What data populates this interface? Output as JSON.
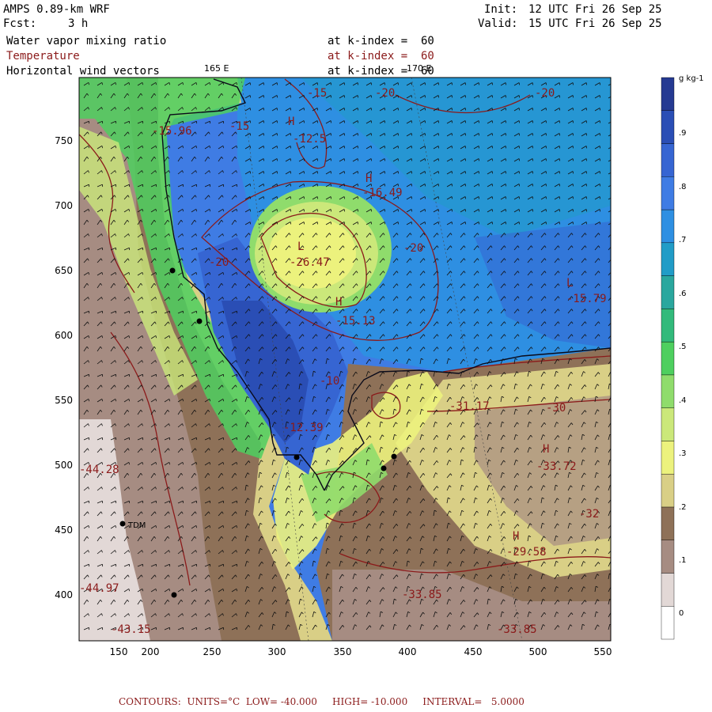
{
  "header": {
    "model": "AMPS 0.89-km WRF",
    "fcst_label": "Fcst:",
    "fcst_value": "3 h",
    "init_label": "Init:",
    "init_value": "12 UTC Fri 26 Sep 25",
    "valid_label": "Valid:",
    "valid_value": "15 UTC Fri 26 Sep 25"
  },
  "fields": [
    {
      "name": "Water vapor mixing ratio",
      "level": "at k-index =  60"
    },
    {
      "name": "Temperature",
      "level": "at k-index =  60"
    },
    {
      "name": "Horizontal wind vectors",
      "level": "at k-index =  60"
    }
  ],
  "map": {
    "meridians": [
      "165 E",
      "170 E"
    ],
    "landmark": "TDM",
    "x_ticks": [
      "150",
      "200",
      "250",
      "300",
      "350",
      "400",
      "450",
      "500",
      "550"
    ],
    "y_ticks": [
      "750",
      "700",
      "650",
      "600",
      "550",
      "500",
      "450",
      "400"
    ],
    "extremes": [
      {
        "type": "H",
        "value": "-12.5"
      },
      {
        "type": "H",
        "value": "-16.49"
      },
      {
        "type": "L",
        "value": "-26.47"
      },
      {
        "type": "H",
        "value": "-15.13"
      },
      {
        "type": "L",
        "value": "-15.79"
      },
      {
        "type": "L",
        "value": "-12.39"
      },
      {
        "type": "H",
        "value": "-33.72"
      },
      {
        "type": "H",
        "value": "-29.58"
      },
      {
        "type": "L",
        "value": "-33.85"
      },
      {
        "type": "L",
        "value": "-15.96"
      },
      {
        "type": "L",
        "value": "-44.28"
      },
      {
        "type": "L",
        "value": "-44.97"
      },
      {
        "type": "L",
        "value": "-43.15"
      }
    ],
    "contour_labels": [
      "-15",
      "-20",
      "-20",
      "-15",
      "-20",
      "-20",
      "-10",
      "-30",
      "-32",
      "-31.17",
      "-33.85"
    ]
  },
  "colorbar": {
    "unit": "g kg-1",
    "levels": [
      "0",
      ".1",
      ".2",
      ".3",
      ".4",
      ".5",
      ".6",
      ".7",
      ".8",
      ".9"
    ],
    "colors": [
      "#ffffff",
      "#e2d8d6",
      "#a68c82",
      "#8e7158",
      "#d9cf86",
      "#ecf27d",
      "#cbe87a",
      "#8fdc6c",
      "#4ecf5f",
      "#32ba7b",
      "#2aa79e",
      "#219cc7",
      "#2e8fe2",
      "#3f7ce4",
      "#3665d2",
      "#2a4eb5",
      "#253a92"
    ]
  },
  "footer": {
    "contours_label": "CONTOURS:",
    "units": "UNITS=°C",
    "low": "LOW= -40.000",
    "high": "HIGH= -10.000",
    "interval": "INTERVAL=   5.0000"
  }
}
